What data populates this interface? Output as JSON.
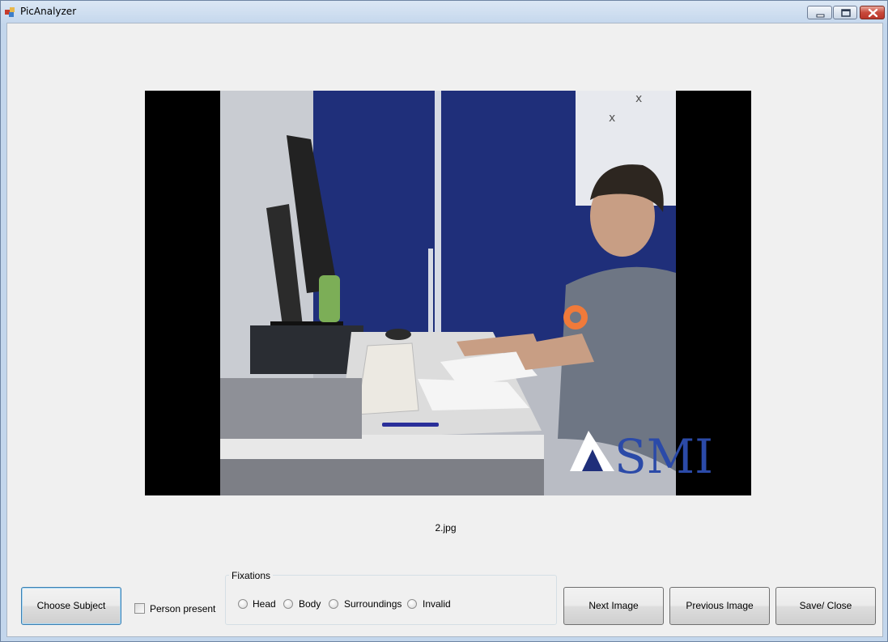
{
  "window": {
    "title": "PicAnalyzer",
    "controls": [
      "minimize-icon",
      "maximize-icon",
      "close-icon"
    ]
  },
  "image": {
    "filename": "2.jpg"
  },
  "buttons": {
    "choose_subject": "Choose Subject",
    "next_image": "Next Image",
    "previous_image": "Previous Image",
    "save_close": "Save/ Close"
  },
  "person_present": {
    "label": "Person present",
    "checked": false
  },
  "fixations": {
    "title": "Fixations",
    "options": [
      {
        "label": "Head",
        "selected": false
      },
      {
        "label": "Body",
        "selected": false
      },
      {
        "label": "Surroundings",
        "selected": false
      },
      {
        "label": "Invalid",
        "selected": false
      }
    ]
  },
  "colors": {
    "fixation_marker": "#f07a3a",
    "backdrop_blue": "#1f2f7a"
  }
}
